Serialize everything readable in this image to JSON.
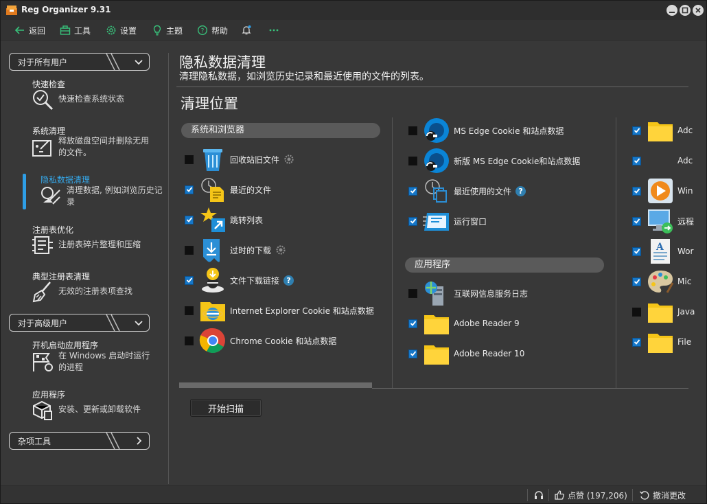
{
  "window": {
    "title": "Reg Organizer 9.31"
  },
  "toolbar": {
    "back": "返回",
    "tools": "工具",
    "settings": "设置",
    "theme": "主题",
    "help": "帮助"
  },
  "sidebar": {
    "section_all_users": "对于所有用户",
    "section_advanced": "对于高级用户",
    "section_misc": "杂项工具",
    "items": [
      {
        "title": "快速检查",
        "desc": "快速检查系统状态"
      },
      {
        "title": "系统清理",
        "desc": "释放磁盘空间并删除无用的文件。"
      },
      {
        "title": "隐私数据清理",
        "desc": "清理数据, 例如浏览历史记录"
      },
      {
        "title": "注册表优化",
        "desc": "注册表碎片整理和压缩"
      },
      {
        "title": "典型注册表清理",
        "desc": "无效的注册表项查找"
      },
      {
        "title": "开机启动应用程序",
        "desc": "在 Windows 启动时运行的进程"
      },
      {
        "title": "应用程序",
        "desc": "安装、更新或卸载软件"
      }
    ]
  },
  "main": {
    "title": "隐私数据清理",
    "subtitle": "清理隐私数据，如浏览历史记录和最近使用的文件的列表。",
    "section": "清理位置",
    "scan_button": "开始扫描"
  },
  "groups": {
    "system_browsers": "系统和浏览器",
    "applications": "应用程序"
  },
  "col1": [
    {
      "label": "回收站旧文件",
      "checked": false,
      "icon": "recycle-bin-icon",
      "gear": true
    },
    {
      "label": "最近的文件",
      "checked": true,
      "icon": "recent-files-icon"
    },
    {
      "label": "跳转列表",
      "checked": true,
      "icon": "jump-list-icon"
    },
    {
      "label": "过时的下载",
      "checked": false,
      "icon": "old-downloads-icon",
      "gear": true
    },
    {
      "label": "文件下载链接",
      "checked": true,
      "icon": "download-links-icon",
      "help": true
    },
    {
      "label": "Internet Explorer Cookie 和站点数据",
      "checked": false,
      "icon": "ie-folder-icon"
    },
    {
      "label": "Chrome Cookie 和站点数据",
      "checked": false,
      "icon": "chrome-icon"
    }
  ],
  "col2": [
    {
      "label": "MS Edge Cookie 和站点数据",
      "checked": false,
      "icon": "edge-icon"
    },
    {
      "label": "新版 MS Edge Cookie和站点数据",
      "checked": false,
      "icon": "edge-icon"
    },
    {
      "label": "最近使用的文件",
      "checked": true,
      "icon": "recent-used-icon",
      "help": true
    },
    {
      "label": "运行窗口",
      "checked": true,
      "icon": "run-window-icon"
    }
  ],
  "col2_apps": [
    {
      "label": "互联网信息服务日志",
      "checked": false,
      "icon": "iis-icon"
    },
    {
      "label": "Adobe Reader 9",
      "checked": true,
      "icon": "folder-icon"
    },
    {
      "label": "Adobe Reader 10",
      "checked": true,
      "icon": "folder-icon"
    }
  ],
  "col3": [
    {
      "label": "Adc",
      "checked": true,
      "icon": "folder-icon"
    },
    {
      "label": "Adc",
      "checked": true,
      "icon": "none"
    },
    {
      "label": "Win",
      "checked": true,
      "icon": "media-player-icon"
    },
    {
      "label": "远程",
      "checked": true,
      "icon": "remote-desktop-icon"
    },
    {
      "label": "Wor",
      "checked": true,
      "icon": "wordpad-icon"
    },
    {
      "label": "Mic",
      "checked": true,
      "icon": "paint-icon"
    },
    {
      "label": "Java",
      "checked": false,
      "icon": "folder-icon"
    },
    {
      "label": "File",
      "checked": true,
      "icon": "folder-icon"
    }
  ],
  "statusbar": {
    "likes": "点赞 (197,206)",
    "undo": "撤消更改"
  },
  "colors": {
    "accent": "#2e9ee6",
    "checkbox": "#1677c8",
    "folder": "#f5c518"
  }
}
